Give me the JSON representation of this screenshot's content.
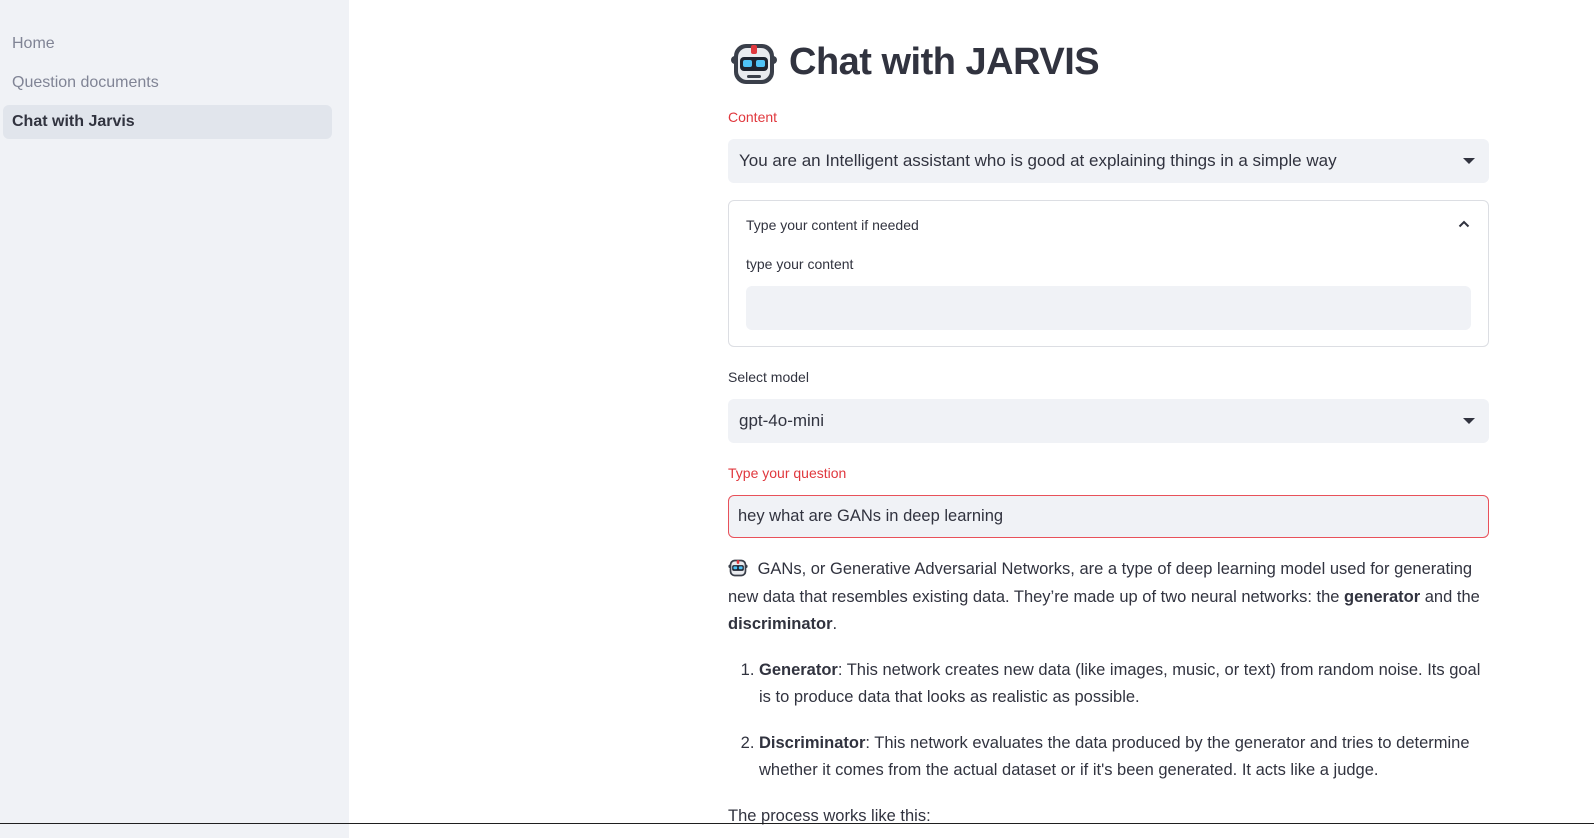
{
  "sidebar": {
    "items": [
      {
        "label": "Home"
      },
      {
        "label": "Question documents"
      },
      {
        "label": "Chat with Jarvis",
        "active": true
      }
    ]
  },
  "header": {
    "title": "Chat with JARVIS",
    "icon": "robot-face-icon"
  },
  "content_select": {
    "label": "Content",
    "value": "You are an Intelligent assistant who is good at explaining things in a simple way"
  },
  "expander": {
    "title": "Type your content if needed",
    "field_label": "type your content",
    "field_value": ""
  },
  "model_select": {
    "label": "Select model",
    "value": "gpt-4o-mini"
  },
  "question": {
    "label": "Type your question",
    "value": "hey what are GANs in deep learning"
  },
  "answer": {
    "intro_1": " GANs, or Generative Adversarial Networks, are a type of deep learning model used for generating new data that resembles existing data. They’re made up of two neural networks: the ",
    "intro_bold_1": "generator",
    "intro_2": " and the ",
    "intro_bold_2": "discriminator",
    "intro_3": ".",
    "items": [
      {
        "term": "Generator",
        "text": ": This network creates new data (like images, music, or text) from random noise. Its goal is to produce data that looks as realistic as possible."
      },
      {
        "term": "Discriminator",
        "text": ": This network evaluates the data produced by the generator and tries to determine whether it comes from the actual dataset or if it's been generated. It acts like a judge."
      }
    ],
    "footer": "The process works like this:"
  },
  "colors": {
    "sidebar_bg": "#f0f2f6",
    "accent_red": "#e0383e",
    "input_bg": "#f0f2f6",
    "active_nav_bg": "#e1e5ec"
  }
}
